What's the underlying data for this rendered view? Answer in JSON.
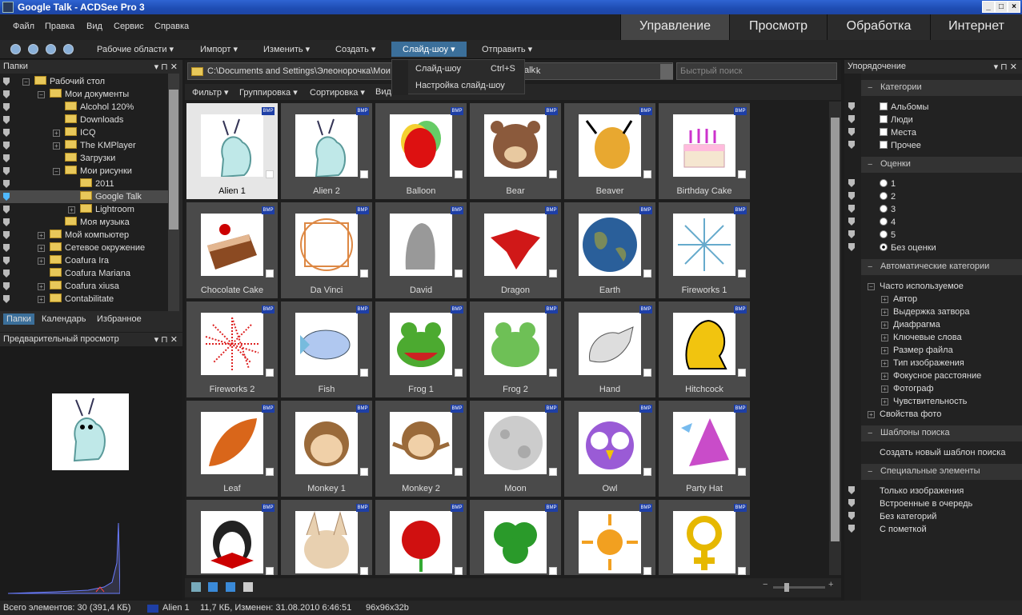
{
  "window": {
    "title": "Google Talk - ACDSee Pro 3"
  },
  "menu": {
    "items": [
      "Файл",
      "Правка",
      "Вид",
      "Сервис",
      "Справка"
    ]
  },
  "modes": {
    "tabs": [
      "Управление",
      "Просмотр",
      "Обработка",
      "Интернет"
    ],
    "active": 0
  },
  "toolbar": {
    "buttons": [
      "Рабочие области",
      "Импорт",
      "Изменить",
      "Создать",
      "Слайд-шоу",
      "Отправить"
    ]
  },
  "dropdown": {
    "item1": "Слайд-шоу",
    "item1_shortcut": "Ctrl+S",
    "item2": "Настройка слайд-шоу"
  },
  "folders": {
    "title": "Папки",
    "items": [
      {
        "label": "Рабочий стол",
        "indent": 0,
        "expand": "−"
      },
      {
        "label": "Мои документы",
        "indent": 1,
        "expand": "−"
      },
      {
        "label": "Alcohol 120%",
        "indent": 2,
        "expand": ""
      },
      {
        "label": "Downloads",
        "indent": 2,
        "expand": ""
      },
      {
        "label": "ICQ",
        "indent": 2,
        "expand": "+"
      },
      {
        "label": "The KMPlayer",
        "indent": 2,
        "expand": "+"
      },
      {
        "label": "Загрузки",
        "indent": 2,
        "expand": ""
      },
      {
        "label": "Мои рисунки",
        "indent": 2,
        "expand": "−"
      },
      {
        "label": "2011",
        "indent": 3,
        "expand": ""
      },
      {
        "label": "Google Talk",
        "indent": 3,
        "expand": ""
      },
      {
        "label": "Lightroom",
        "indent": 3,
        "expand": "+"
      },
      {
        "label": "Моя музыка",
        "indent": 2,
        "expand": ""
      },
      {
        "label": "Мой компьютер",
        "indent": 1,
        "expand": "+"
      },
      {
        "label": "Сетевое окружение",
        "indent": 1,
        "expand": "+"
      },
      {
        "label": "Coafura Ira",
        "indent": 1,
        "expand": "+"
      },
      {
        "label": "Coafura Mariana",
        "indent": 1,
        "expand": ""
      },
      {
        "label": "Coafura xiusa",
        "indent": 1,
        "expand": "+"
      },
      {
        "label": "Contabilitate",
        "indent": 1,
        "expand": "+"
      }
    ],
    "tabs": [
      "Папки",
      "Календарь",
      "Избранное"
    ]
  },
  "preview": {
    "title": "Предварительный просмотр"
  },
  "browser": {
    "path": "C:\\Documents and Settings\\Элеонорочка\\Мои документы\\Мои рисунки\\Google Talk",
    "path_tail": "alk",
    "search_placeholder": "Быстрый поиск",
    "filters": [
      "Фильтр",
      "Группировка",
      "Сортировка",
      "Вид"
    ],
    "thumbnails": [
      "Alien 1",
      "Alien 2",
      "Balloon",
      "Bear",
      "Beaver",
      "Birthday Cake",
      "Chocolate Cake",
      "Da Vinci",
      "David",
      "Dragon",
      "Earth",
      "Fireworks 1",
      "Fireworks 2",
      "Fish",
      "Frog 1",
      "Frog 2",
      "Hand",
      "Hitchcock",
      "Leaf",
      "Monkey 1",
      "Monkey 2",
      "Moon",
      "Owl",
      "Party Hat",
      "",
      "",
      "",
      "",
      "",
      ""
    ],
    "badge": "BMP"
  },
  "organize": {
    "title": "Упорядочение",
    "categories_title": "Категории",
    "categories": [
      "Альбомы",
      "Люди",
      "Места",
      "Прочее"
    ],
    "ratings_title": "Оценки",
    "ratings": [
      "1",
      "2",
      "3",
      "4",
      "5",
      "Без оценки"
    ],
    "auto_title": "Автоматические категории",
    "auto_root": "Часто используемое",
    "auto_items": [
      "Автор",
      "Выдержка затвора",
      "Диафрагма",
      "Ключевые слова",
      "Размер файла",
      "Тип изображения",
      "Фокусное расстояние",
      "Фотограф",
      "Чувствительность"
    ],
    "photo_props": "Свойства фото",
    "templates_title": "Шаблоны поиска",
    "templates_create": "Создать новый шаблон поиска",
    "special_title": "Специальные элементы",
    "special": [
      "Только изображения",
      "Встроенные в очередь",
      "Без категорий",
      "С пометкой"
    ]
  },
  "status": {
    "total": "Всего элементов: 30  (391,4 КБ)",
    "file": "Alien 1",
    "info": "11,7 КБ, Изменен: 31.08.2010 6:46:51",
    "dims": "96x96x32b"
  }
}
